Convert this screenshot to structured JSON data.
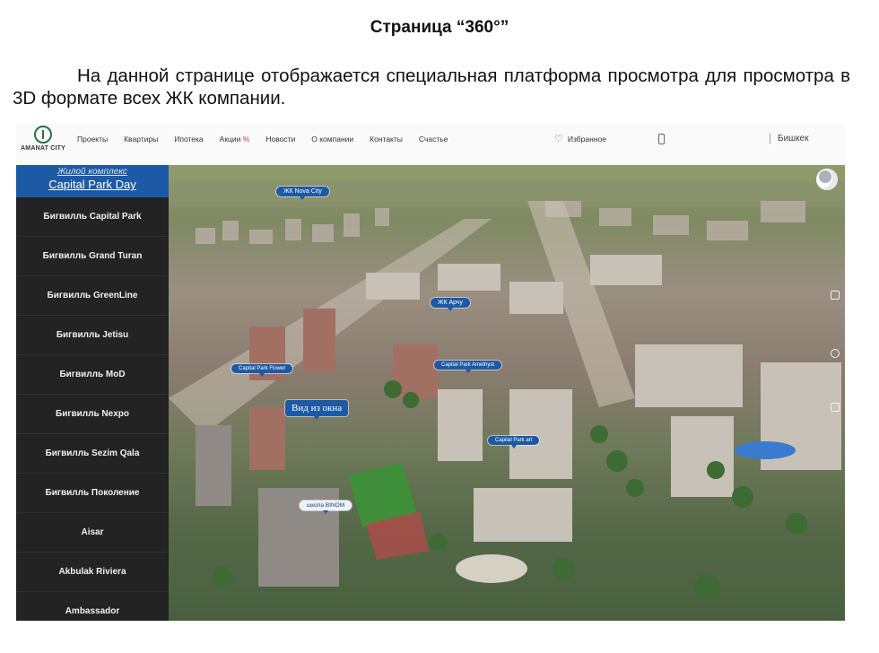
{
  "document": {
    "heading": "Страница “360°”",
    "paragraph": "На данной странице отображается специальная платформа просмотра для просмотра в 3D формате всех ЖК компании."
  },
  "header": {
    "logo_text": "AMANAT CITY",
    "nav": [
      {
        "label": "Проекты"
      },
      {
        "label": "Квартиры"
      },
      {
        "label": "Ипотека"
      },
      {
        "label": "Акции",
        "suffix": "%"
      },
      {
        "label": "Новости"
      },
      {
        "label": "О компании"
      },
      {
        "label": "Контакты"
      },
      {
        "label": "Счастье"
      }
    ],
    "favorites_label": "Избранное",
    "city": "Бишкек",
    "icons": {
      "favorites": "heart-icon",
      "phone": "phone-icon"
    }
  },
  "sidebar": {
    "subtitle": "Жилой комплекс",
    "title": "Capital Park Day",
    "items": [
      {
        "label": "Бигвилль Capital Park"
      },
      {
        "label": "Бигвилль Grand Turan"
      },
      {
        "label": "Бигвилль GreenLine"
      },
      {
        "label": "Бигвилль Jetisu"
      },
      {
        "label": "Бигвилль MoD"
      },
      {
        "label": "Бигвилль Nexpo"
      },
      {
        "label": "Бигвилль Sezim Qala"
      },
      {
        "label": "Бигвилль Поколение"
      },
      {
        "label": "Aisar"
      },
      {
        "label": "Akbulak Riviera"
      },
      {
        "label": "Ambassador"
      }
    ]
  },
  "map": {
    "labels": [
      {
        "text": "ЖК Nova City"
      },
      {
        "text": "ЖК Арчу"
      },
      {
        "text": "Capital Park Flower"
      },
      {
        "text": "Capital Park Amethyst"
      },
      {
        "text": "Вид из окна"
      },
      {
        "text": "Capital Park art"
      },
      {
        "text": "школа BINOM"
      }
    ],
    "colors": {
      "pin": "#1d5aa5",
      "grass": "#4f7a3e",
      "roof": "#b9b0a6"
    }
  }
}
